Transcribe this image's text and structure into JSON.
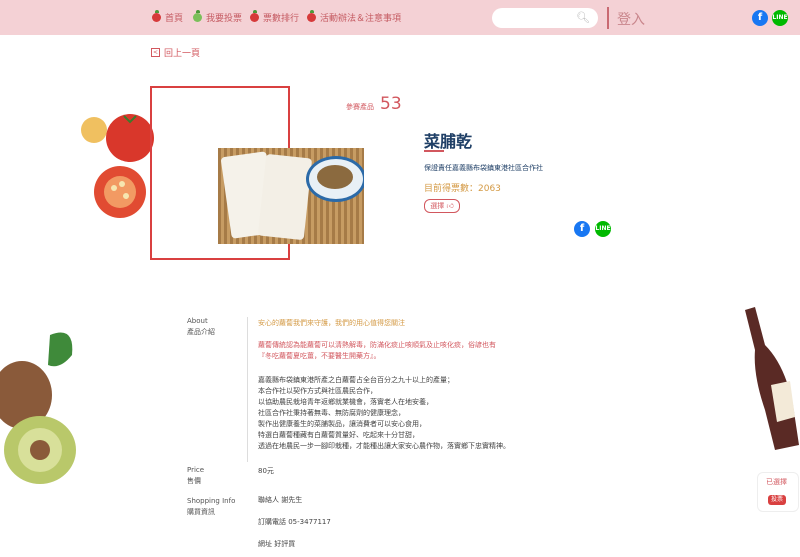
{
  "nav": {
    "items": [
      {
        "label": "首頁",
        "icon": "apple-icon"
      },
      {
        "label": "我要投票",
        "icon": "green-apple-icon"
      },
      {
        "label": "票數排行",
        "icon": "apple-icon"
      },
      {
        "label": "活動辦法＆注意事項",
        "icon": "apple-icon"
      }
    ],
    "search_placeholder": "",
    "login": "登入"
  },
  "back_label": "回上一頁",
  "product": {
    "rank_label": "參賽產品",
    "rank_number": "53",
    "name": "菜脯乾",
    "organization": "保證責任嘉義縣布袋鎮東港社區合作社",
    "votes_label": "目前得票數：2063",
    "vote_button": "選擇"
  },
  "about": {
    "label_en": "About",
    "label_zh": "產品介紹",
    "tagline": "安心的蘿蔔我們來守護，我們的用心值得您關注",
    "red_lines": [
      "蘿蔔傳統認為能蘿蔔可以清熱解毒，防滿化痰止咳順氣及止咳化痰，俗諺也有",
      "『冬吃蘿蔔夏吃薑，不要醫生開藥方』。"
    ],
    "body_lines": [
      "嘉義縣布袋鎮東港所產之白蘿蔔占全台百分之九十以上的產量；",
      "本合作社以契作方式與社區農民合作，",
      "以協助農民栽培青年返鄉就業機會，落實老人在地安養，",
      "社區合作社秉持著無毒、無防腐劑的健康理念，",
      "製作出健康養生的菜脯製品，讓消費者可以安心食用，",
      "特選白蘿蔔種藏有白蘿蔔質量好、吃起來十分甘甜，",
      "透過在地農民一步一腳印栽種，才能種出讓大家安心農作物，落實鄉下忠實精神。"
    ]
  },
  "price": {
    "label_en": "Price",
    "label_zh": "售價",
    "value": "80元"
  },
  "shopping": {
    "label_en": "Shopping Info",
    "label_zh": "購買資訊",
    "contact": "聯絡人  謝先生",
    "phone": "訂購電話  05-3477117",
    "website": "網址  好評買"
  },
  "side": {
    "voted_label": "已選擇",
    "vote_btn": "投票"
  },
  "colors": {
    "topbar": "#f4d1d5",
    "accent_red": "#d2575e",
    "title_blue": "#1f3f66",
    "votes_orange": "#d49a45"
  }
}
